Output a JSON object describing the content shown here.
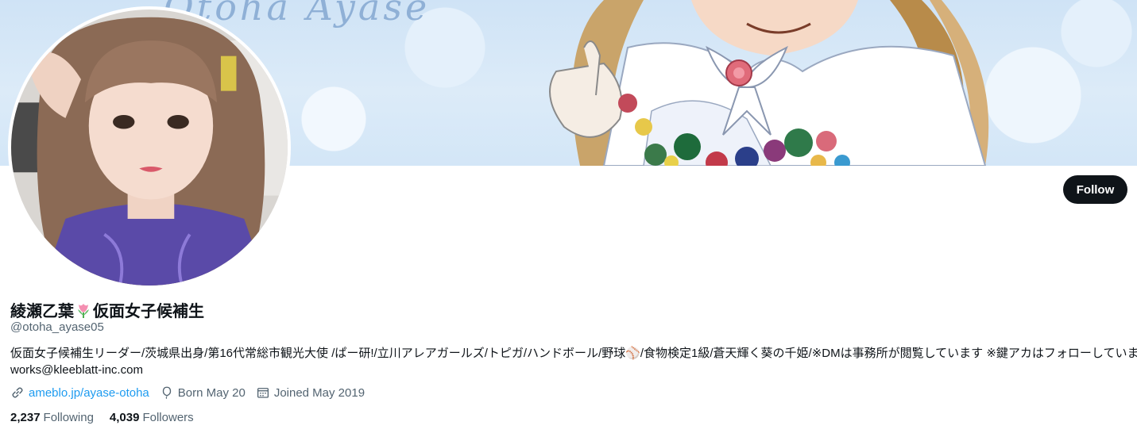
{
  "banner": {
    "title": "Otoha Ayase"
  },
  "profile": {
    "display_name_part1": "綾瀬乙葉",
    "display_name_emoji": "tulip-icon",
    "display_name_part2": "仮面女子候補生",
    "handle": "@otoha_ayase05",
    "bio_line1": "仮面女子候補生リーダー/茨城県出身/第16代常総市観光大使 /ぱー研!/立川アレアガールズ/トピガ/ハンドボール/野球⚾/食物検定1級/蒼天輝く葵の千姫/※DMは事務所が閲覧しています ※鍵アカはフォローしていません。",
    "bio_line2": "works@kleeblatt-inc.com",
    "link_icon": "link-icon",
    "link_text": "ameblo.jp/ayase-otoha",
    "birthday_icon": "balloon-icon",
    "birthday_text": "Born May 20",
    "joined_icon": "calendar-icon",
    "joined_text": "Joined May 2019",
    "following_count": "2,237",
    "following_label": "Following",
    "followers_count": "4,039",
    "followers_label": "Followers"
  },
  "actions": {
    "follow_label": "Follow"
  },
  "colors": {
    "accent": "#1d9bf0",
    "text_primary": "#0f1419",
    "text_secondary": "#536471",
    "button_bg": "#0f1419"
  }
}
